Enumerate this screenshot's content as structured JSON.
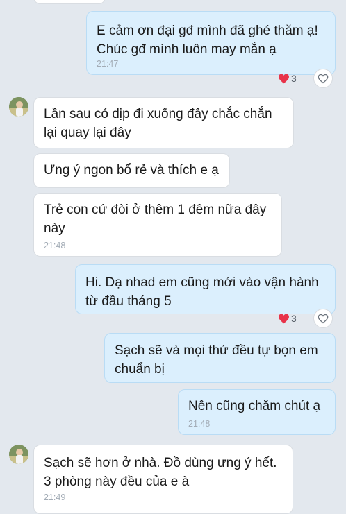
{
  "messages": [
    {
      "text": "E cảm ơn đại gđ mình đã ghé thăm ạ!\nChúc gđ mình luôn may mắn ạ",
      "time": "21:47",
      "reaction_count": "3"
    },
    {
      "text": "Lần sau có dịp đi xuống đây chắc chắn\nlại quay lại đây"
    },
    {
      "text": "Ưng ý ngon bổ rẻ và thích e ạ"
    },
    {
      "text": "Trẻ con cứ đòi ở thêm 1 đêm nữa đây\nnày",
      "time": "21:48"
    },
    {
      "text": "Hi. Dạ nhad em cũng mới vào vận hành\ntừ đầu tháng 5",
      "reaction_count": "3"
    },
    {
      "text": "Sạch sẽ và mọi thứ đều tự bọn em\nchuẩn bị"
    },
    {
      "text": "Nên cũng chăm chút ạ",
      "time": "21:48"
    },
    {
      "text": "Sạch sẽ hơn ở nhà. Đồ dùng ưng ý hết.\n3 phòng này đều của e à",
      "time": "21:49"
    }
  ],
  "colors": {
    "incoming_bubble": "#ffffff",
    "outgoing_bubble": "#dbeffd",
    "background": "#e3e8ee",
    "reaction_heart": "#e8334a"
  },
  "icons": {
    "reaction": "heart-icon",
    "react_button": "heart-outline-icon"
  }
}
